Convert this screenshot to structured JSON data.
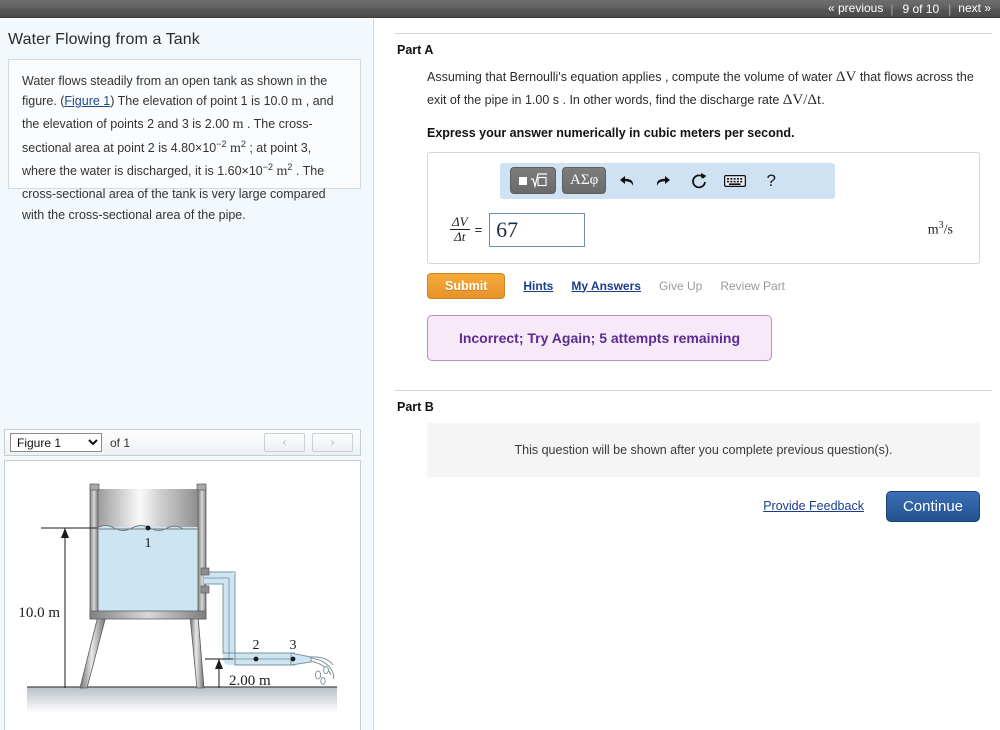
{
  "topbar": {
    "previous_label": "« previous",
    "counter_label": "9 of 10",
    "next_label": "next »",
    "separator": "|"
  },
  "left_panel": {
    "problem_title": "Water Flowing from a Tank",
    "problem_text_part1": "Water flows steadily from an open tank as shown in the figure. (",
    "figure_link_label": "Figure 1",
    "problem_text_part2": ") The elevation of point 1 is 10.0 ",
    "unit_m_1": "m",
    "problem_text_part3": " , and the elevation of points 2 and 3 is 2.00 ",
    "unit_m_2": "m",
    "problem_text_part4": " . The cross-sectional area at point 2 is 4.80×10",
    "exp_1": "−2",
    "unit_m2_1": "m",
    "exp_sq_1": "2",
    "problem_text_part5": " ; at point 3, where the water is discharged, it is 1.60×10",
    "exp_2": "−2",
    "unit_m2_2": "m",
    "exp_sq_2": "2",
    "problem_text_part6": " . The cross-sectional area of the tank is very large compared with the cross-sectional area of the pipe."
  },
  "figure_bar": {
    "selected_figure": "Figure 1",
    "options": [
      "Figure 1"
    ],
    "of_label": "of 1",
    "prev_icon": "chevron-left-icon",
    "next_icon": "chevron-right-icon",
    "prev_glyph": "‹",
    "next_glyph": "›"
  },
  "figure": {
    "label_point_1": "1",
    "label_point_2": "2",
    "label_point_3": "3",
    "dim_height_tank": "10.0 m",
    "dim_height_pipe": "2.00 m"
  },
  "part_a": {
    "heading": "Part A",
    "question_prefix": "Assuming that Bernoulli's equation applies , compute the volume of water ",
    "sym_dV": "ΔV",
    "question_mid": " that flows across the exit of the pipe in 1.00 s . In other words, find the discharge rate ",
    "sym_rate": "ΔV/Δt",
    "question_suffix": ".",
    "instruction": "Express your answer numerically in cubic meters per second.",
    "toolbar": {
      "template_button_icon": "math-template-icon",
      "template_button_label": "▪√▫",
      "greek_button_icon": "greek-symbols-icon",
      "greek_button_label": "ΑΣφ",
      "undo_icon": "undo-arrow-icon",
      "undo_glyph": "↩",
      "redo_icon": "redo-arrow-icon",
      "redo_glyph": "↪",
      "reset_icon": "reset-circular-arrow-icon",
      "reset_glyph": "↻",
      "keyboard_icon": "keyboard-icon",
      "keyboard_glyph": "⌨",
      "help_icon": "question-mark-help-icon",
      "help_glyph": "?"
    },
    "answer_label_num": "ΔV",
    "answer_label_den": "Δt",
    "equals": "=",
    "answer_value": "67",
    "answer_placeholder": "",
    "units_base": "m",
    "units_exp": "3",
    "units_per": "/s",
    "submit_label": "Submit",
    "hints_label": "Hints",
    "my_answers_label": "My Answers",
    "give_up_label": "Give Up",
    "review_part_label": "Review Part",
    "feedback_message": "Incorrect; Try Again; 5 attempts remaining"
  },
  "part_b": {
    "heading": "Part B",
    "locked_message": "This question will be shown after you complete previous question(s)."
  },
  "footer": {
    "provide_feedback_label": "Provide Feedback",
    "continue_label": "Continue"
  },
  "colors": {
    "topbar_bg": "#5c5c5c",
    "left_panel_bg": "#f3f8fc",
    "accent_link": "#1a3e8c",
    "submit_orange": "#e8932a",
    "feedback_purple": "#5c2d91",
    "feedback_bg": "#f7e9f7",
    "continue_blue": "#23528f",
    "toolbar_blue": "#cfe2f3",
    "water_blue": "#cde5f2"
  }
}
